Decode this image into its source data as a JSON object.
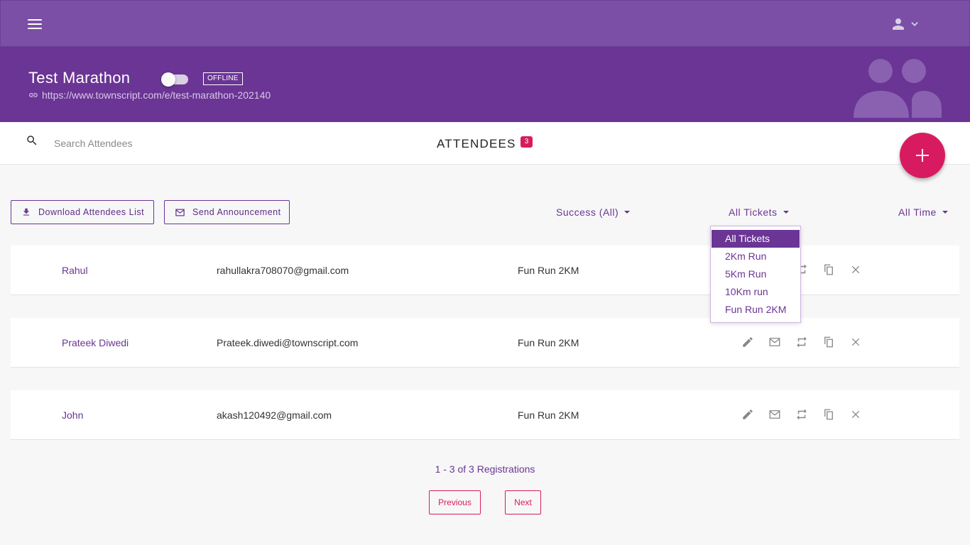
{
  "header": {
    "menu_icon": "hamburger-menu-icon",
    "user_icon": "user-icon",
    "user_menu_caret": "chevron-down-icon"
  },
  "event": {
    "title": "Test Marathon",
    "status": "OFFLINE",
    "url": "https://www.townscript.com/e/test-marathon-202140",
    "url_icon": "link-icon",
    "illustration": "people-icon"
  },
  "search": {
    "placeholder": "Search Attendees",
    "icon": "search-icon"
  },
  "attendees": {
    "title": "ATTENDEES",
    "count": "3"
  },
  "fab": {
    "icon": "plus-icon"
  },
  "actions": {
    "download_label": "Download Attendees List",
    "download_icon": "download-icon",
    "announce_label": "Send Announcement",
    "announce_icon": "mail-icon"
  },
  "filters": {
    "status": "Success (All)",
    "tickets": "All Tickets",
    "time": "All Time"
  },
  "ticket_dropdown": {
    "options": [
      "All Tickets",
      "2Km Run",
      "5Km Run",
      "10Km run",
      "Fun Run 2KM"
    ],
    "selected": "All Tickets"
  },
  "rows": [
    {
      "name": "Rahul",
      "email": "rahullakra708070@gmail.com",
      "ticket": "Fun Run 2KM"
    },
    {
      "name": "Prateek Diwedi",
      "email": "Prateek.diwedi@townscript.com",
      "ticket": "Fun Run 2KM"
    },
    {
      "name": "John",
      "email": "akash120492@gmail.com",
      "ticket": "Fun Run 2KM"
    }
  ],
  "row_action_icons": [
    "edit-icon",
    "mail-icon",
    "transfer-icon",
    "copy-icon",
    "close-icon"
  ],
  "pagination": {
    "info": "1 - 3 of 3 Registrations",
    "previous_label": "Previous",
    "next_label": "Next"
  },
  "colors": {
    "topbar": "#7b4fa5",
    "header": "#6a3594",
    "accent": "#d81b60",
    "primary_text": "#6a3594"
  }
}
